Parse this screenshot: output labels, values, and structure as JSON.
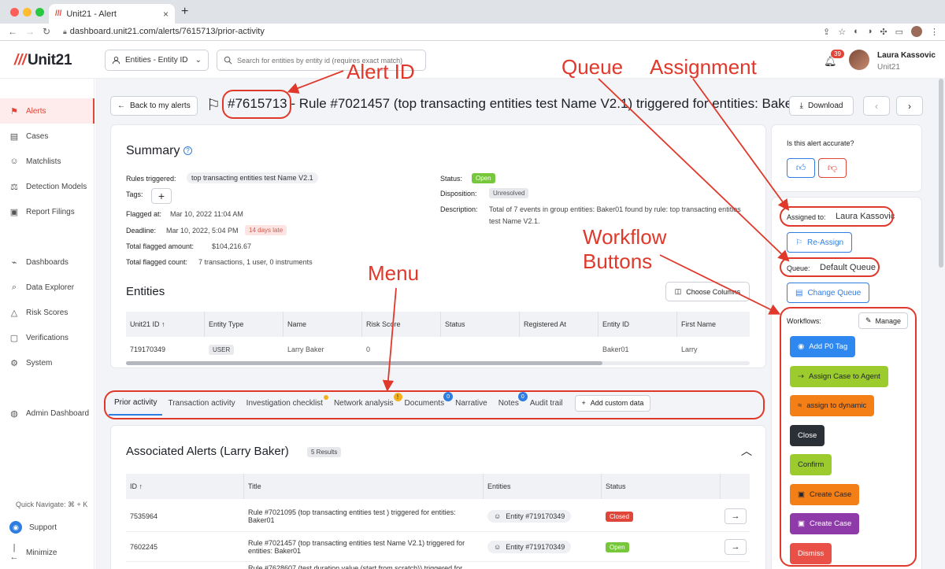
{
  "browser": {
    "tab_title": "Unit21 - Alert",
    "tab_logo": "///",
    "url": "dashboard.unit21.com/alerts/7615713/prior-activity",
    "traffic_colors": [
      "#ff5f57",
      "#febc2e",
      "#28c840"
    ]
  },
  "header": {
    "logo_slashes": "///",
    "logo_text": "Unit21",
    "entity_select": "Entities - Entity ID",
    "search_placeholder": "Search for entities by entity id (requires exact match)",
    "notification_count": "39",
    "user_name": "Laura Kassovic",
    "user_org": "Unit21"
  },
  "sidebar": {
    "items": [
      {
        "label": "Alerts",
        "icon": "flag-icon",
        "active": true
      },
      {
        "label": "Cases",
        "icon": "briefcase-icon"
      },
      {
        "label": "Matchlists",
        "icon": "person-add-icon"
      },
      {
        "label": "Detection Models",
        "icon": "scale-icon"
      },
      {
        "label": "Report Filings",
        "icon": "report-icon"
      },
      {
        "label": "Dashboards",
        "icon": "chart-icon"
      },
      {
        "label": "Data Explorer",
        "icon": "explore-icon"
      },
      {
        "label": "Risk Scores",
        "icon": "triangle-icon"
      },
      {
        "label": "Verifications",
        "icon": "id-card-icon"
      },
      {
        "label": "System",
        "icon": "gear-icon"
      },
      {
        "label": "Admin Dashboard",
        "icon": "globe-icon"
      }
    ],
    "quick_navigate": "Quick Navigate: ⌘ + K",
    "support": "Support",
    "minimize": "Minimize"
  },
  "page": {
    "back_label": "Back to my alerts",
    "alert_id": "#7615713",
    "alert_title_rest": " - Rule #7021457 (top transacting entities test Name V2.1) triggered for entities: Baker01",
    "download_label": "Download"
  },
  "summary": {
    "title": "Summary",
    "rules_triggered_label": "Rules triggered:",
    "rules_triggered_value": "top transacting entities test Name V2.1",
    "tags_label": "Tags:",
    "flagged_at_label": "Flagged at:",
    "flagged_at_value": "Mar 10, 2022 11:04 AM",
    "deadline_label": "Deadline:",
    "deadline_value": "Mar 10, 2022, 5:04 PM",
    "deadline_late": "14 days late",
    "flagged_amount_label": "Total flagged amount:",
    "flagged_amount_value": "$104,216.67",
    "flagged_count_label": "Total flagged count:",
    "flagged_count_value": "7 transactions, 1 user, 0 instruments",
    "status_label": "Status:",
    "status_value": "Open",
    "disposition_label": "Disposition:",
    "disposition_value": "Unresolved",
    "description_label": "Description:",
    "description_line1": "Total of 7 events in group entities: Baker01 found by rule: top transacting entities",
    "description_line2": "test Name V2.1."
  },
  "entities": {
    "title": "Entities",
    "choose_columns": "Choose Columns",
    "columns": [
      "Unit21 ID ↑",
      "Entity Type",
      "Name",
      "Risk Score",
      "Status",
      "Registered At",
      "Entity ID",
      "First Name"
    ],
    "row": [
      "719170349",
      "USER",
      "Larry Baker",
      "0",
      "",
      "",
      "Baker01",
      "Larry"
    ]
  },
  "tabs": {
    "items": [
      "Prior activity",
      "Transaction activity",
      "Investigation checklist",
      "Network analysis",
      "Documents",
      "Narrative",
      "Notes",
      "Audit trail"
    ],
    "documents_count": "0",
    "notes_count": "0",
    "network_badge": "!",
    "add_custom": "Add custom data"
  },
  "associated": {
    "title": "Associated Alerts (Larry Baker)",
    "results": "5 Results",
    "columns": [
      "ID ↑",
      "Title",
      "Entities",
      "Status"
    ],
    "rows": [
      {
        "id": "7535964",
        "title1": "Rule #7021095 (top transacting entities test ) triggered for entities:",
        "title2": "Baker01",
        "entity": "Entity #719170349",
        "status": "Closed"
      },
      {
        "id": "7602245",
        "title1": "Rule #7021457 (top transacting entities test Name V2.1) triggered for",
        "title2": "entities: Baker01",
        "entity": "Entity #719170349",
        "status": "Open"
      },
      {
        "id": "",
        "title1": "Rule #7628607 (test duration value (start from scratch)) triggered for",
        "title2": "",
        "entity": "",
        "status": ""
      }
    ]
  },
  "right_panel": {
    "accurate_q": "Is this alert accurate?",
    "assigned_label": "Assigned to:",
    "assigned_value": "Laura Kassovic",
    "reassign": "Re-Assign",
    "queue_label": "Queue:",
    "queue_value": "Default Queue",
    "change_queue": "Change Queue",
    "workflows_label": "Workflows:",
    "manage": "Manage",
    "workflows": [
      {
        "label": "Add P0 Tag",
        "color": "#2f88f0",
        "text": "#ffffff",
        "icon": "check-circle-icon"
      },
      {
        "label": "Assign Case to Agent",
        "color": "#9bcb2c",
        "text": "#1f2430",
        "icon": "assign-icon"
      },
      {
        "label": "assign to dynamic",
        "color": "#f57f17",
        "text": "#1f2430",
        "icon": "double-chevron-icon"
      },
      {
        "label": "Close",
        "color": "#2b2f36",
        "text": "#ffffff",
        "icon": ""
      },
      {
        "label": "Confirm",
        "color": "#9bcb2c",
        "text": "#1f2430",
        "icon": ""
      },
      {
        "label": "Create Case",
        "color": "#f57f17",
        "text": "#1f2430",
        "icon": "briefcase-icon"
      },
      {
        "label": "Create Case",
        "color": "#8e3aa8",
        "text": "#ffffff",
        "icon": "briefcase-icon"
      },
      {
        "label": "Dismiss",
        "color": "#e85048",
        "text": "#ffffff",
        "icon": ""
      }
    ]
  },
  "annotations": {
    "alert_id": "Alert ID",
    "queue": "Queue",
    "assignment": "Assignment",
    "workflow_line1": "Workflow",
    "workflow_line2": "Buttons",
    "menu": "Menu",
    "color": "#e0382b"
  }
}
